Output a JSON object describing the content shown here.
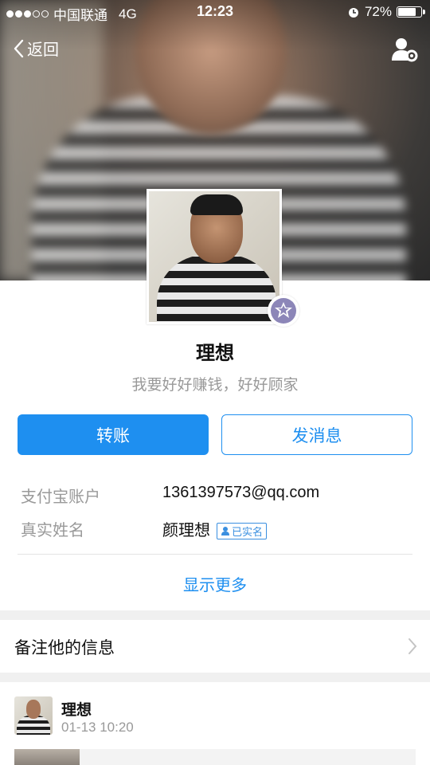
{
  "status_bar": {
    "carrier": "中国联通",
    "network": "4G",
    "time": "12:23",
    "battery": "72%",
    "battery_level": 0.72
  },
  "nav": {
    "back_label": "返回",
    "settings_icon": "user-settings-icon"
  },
  "profile": {
    "name": "理想",
    "signature": "我要好好赚钱，好好顾家",
    "badge_icon": "membership-star-icon"
  },
  "actions": {
    "transfer_label": "转账",
    "message_label": "发消息"
  },
  "info": {
    "account_label": "支付宝账户",
    "account_value": "1361397573@qq.com",
    "realname_label": "真实姓名",
    "realname_value": "颜理想",
    "verified_label": "已实名",
    "show_more_label": "显示更多"
  },
  "remark": {
    "label": "备注他的信息"
  },
  "feed": {
    "name": "理想",
    "time": "01-13 10:20"
  },
  "colors": {
    "accent": "#1e8ff0",
    "muted_text": "#999999",
    "background": "#f0f0f0"
  }
}
